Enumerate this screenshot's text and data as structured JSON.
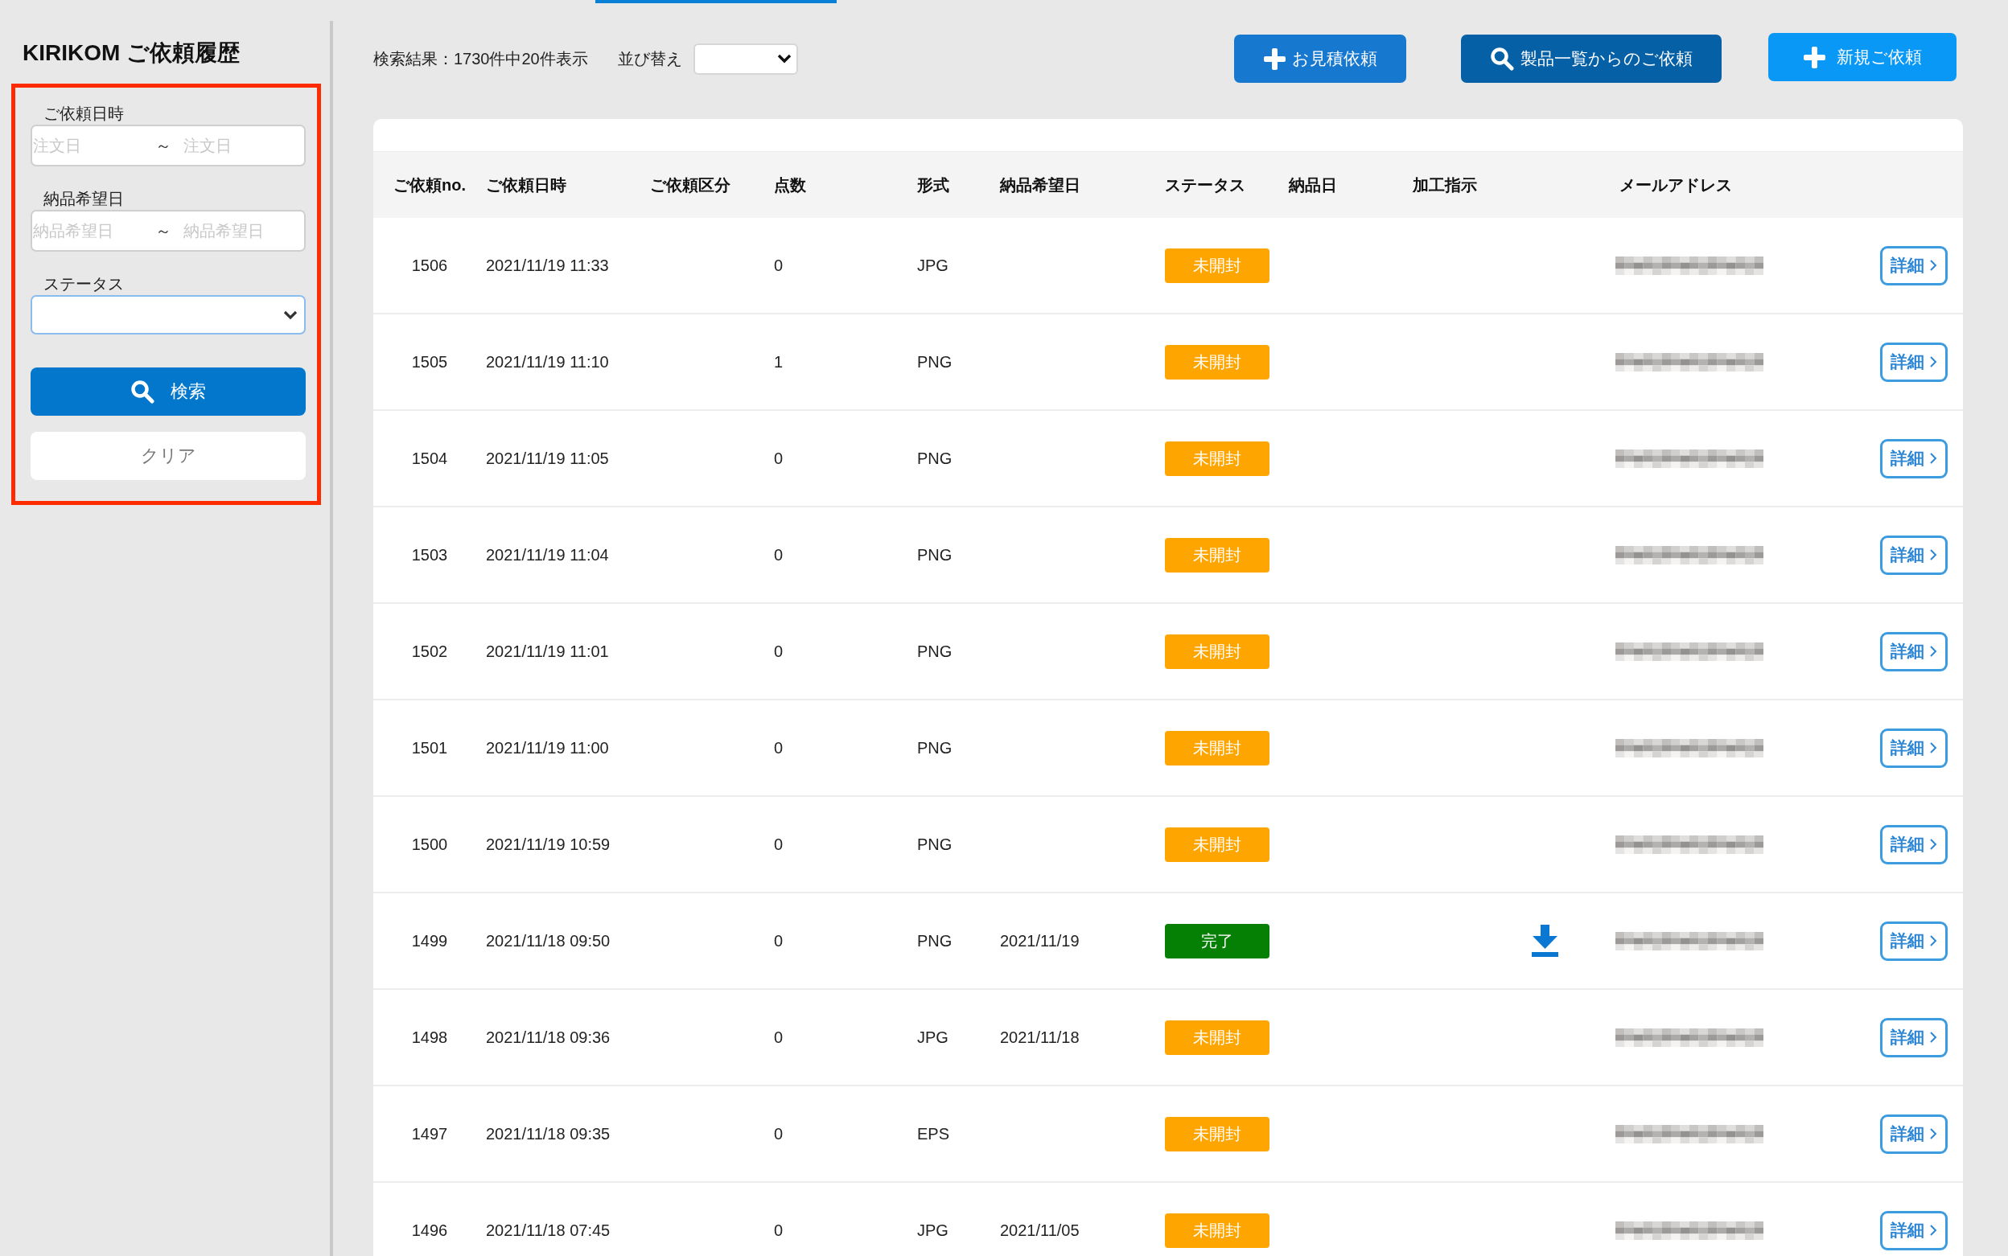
{
  "sidebar": {
    "title": "KIRIKOM ご依頼履歴",
    "filters": [
      {
        "kind": "date_range",
        "label": "ご依頼日時",
        "focused": false,
        "from": {
          "placeholder": "注文日"
        },
        "separator": "～",
        "to": {
          "placeholder": "注文日"
        }
      },
      {
        "kind": "date_range",
        "label": "納品希望日",
        "focused": false,
        "from": {
          "placeholder": "納品希望日"
        },
        "separator": "～",
        "to": {
          "placeholder": "納品希望日"
        }
      },
      {
        "kind": "select",
        "label": "ステータス",
        "focused": true
      }
    ],
    "search_button": {
      "label": "検索"
    },
    "clear_button": {
      "label": "クリア"
    }
  },
  "toolbar": {
    "result_summary": "検索結果：1730件中20件表示",
    "sort": {
      "label": "並び替え"
    },
    "actions": [
      {
        "kind": "quote",
        "label": "お見積依頼"
      },
      {
        "kind": "catalog",
        "label": "製品一覧からのご依頼"
      },
      {
        "kind": "new",
        "label": "新規ご依頼"
      }
    ]
  },
  "table": {
    "columns": [
      "ご依頼no.",
      "ご依頼日時",
      "ご依頼区分",
      "点数",
      "形式",
      "納品希望日",
      "ステータス",
      "納品日",
      "加工指示",
      "メールアドレス"
    ],
    "rows": [
      {
        "no": "1506",
        "requested_at": "2021/11/19 11:33",
        "count": "0",
        "format": "JPG",
        "status": {
          "label": "未開封",
          "color": "#ffa500"
        },
        "download": false,
        "detail_button": "詳細"
      },
      {
        "no": "1505",
        "requested_at": "2021/11/19 11:10",
        "count": "1",
        "format": "PNG",
        "status": {
          "label": "未開封",
          "color": "#ffa500"
        },
        "download": false,
        "detail_button": "詳細"
      },
      {
        "no": "1504",
        "requested_at": "2021/11/19 11:05",
        "count": "0",
        "format": "PNG",
        "status": {
          "label": "未開封",
          "color": "#ffa500"
        },
        "download": false,
        "detail_button": "詳細"
      },
      {
        "no": "1503",
        "requested_at": "2021/11/19 11:04",
        "count": "0",
        "format": "PNG",
        "status": {
          "label": "未開封",
          "color": "#ffa500"
        },
        "download": false,
        "detail_button": "詳細"
      },
      {
        "no": "1502",
        "requested_at": "2021/11/19 11:01",
        "count": "0",
        "format": "PNG",
        "status": {
          "label": "未開封",
          "color": "#ffa500"
        },
        "download": false,
        "detail_button": "詳細"
      },
      {
        "no": "1501",
        "requested_at": "2021/11/19 11:00",
        "count": "0",
        "format": "PNG",
        "status": {
          "label": "未開封",
          "color": "#ffa500"
        },
        "download": false,
        "detail_button": "詳細"
      },
      {
        "no": "1500",
        "requested_at": "2021/11/19 10:59",
        "count": "0",
        "format": "PNG",
        "status": {
          "label": "未開封",
          "color": "#ffa500"
        },
        "download": false,
        "detail_button": "詳細"
      },
      {
        "no": "1499",
        "requested_at": "2021/11/18 09:50",
        "count": "0",
        "format": "PNG",
        "desired_date": "2021/11/19",
        "status": {
          "label": "完了",
          "color": "#058005"
        },
        "download": true,
        "detail_button": "詳細"
      },
      {
        "no": "1498",
        "requested_at": "2021/11/18 09:36",
        "count": "0",
        "format": "JPG",
        "desired_date": "2021/11/18",
        "status": {
          "label": "未開封",
          "color": "#ffa500"
        },
        "download": false,
        "detail_button": "詳細"
      },
      {
        "no": "1497",
        "requested_at": "2021/11/18 09:35",
        "count": "0",
        "format": "EPS",
        "status": {
          "label": "未開封",
          "color": "#ffa500"
        },
        "download": false,
        "detail_button": "詳細"
      },
      {
        "no": "1496",
        "requested_at": "2021/11/18 07:45",
        "count": "0",
        "format": "JPG",
        "desired_date": "2021/11/05",
        "status": {
          "label": "未開封",
          "color": "#ffa500"
        },
        "download": false,
        "detail_button": "詳細"
      }
    ]
  }
}
